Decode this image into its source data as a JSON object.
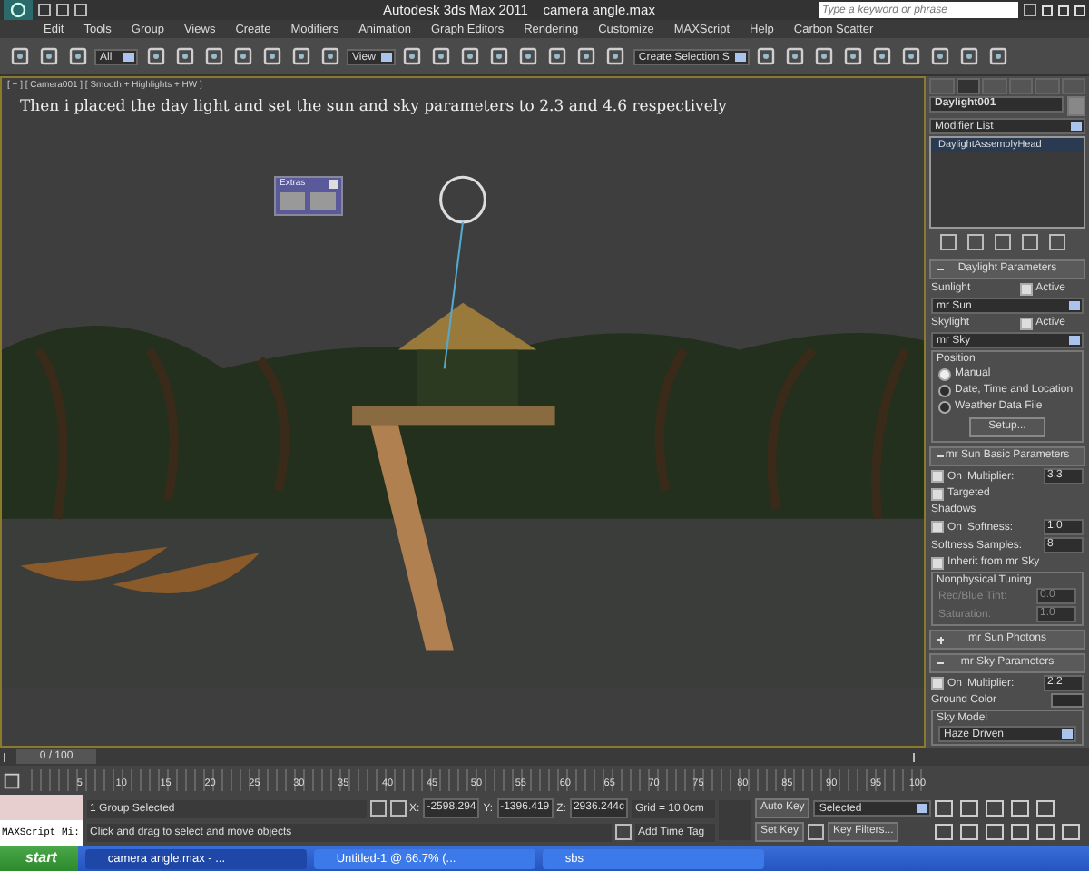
{
  "title_bar": {
    "app": "Autodesk 3ds Max  2011",
    "file": "camera angle.max",
    "search": {
      "placeholder": "Type a keyword or phrase"
    }
  },
  "menu": [
    "Edit",
    "Tools",
    "Group",
    "Views",
    "Create",
    "Modifiers",
    "Animation",
    "Graph Editors",
    "Rendering",
    "Customize",
    "MAXScript",
    "Help",
    "Carbon Scatter"
  ],
  "toolbar": {
    "dropdowns": [
      {
        "value": "All"
      },
      {
        "value": "View"
      },
      {
        "value": "Create Selection S"
      }
    ]
  },
  "viewport": {
    "label": "[ + ] [ Camera001 ] [ Smooth + Highlights + HW ]",
    "caption": "Then i placed the day light and set the sun and sky parameters to 2.3 and 4.6 respectively",
    "extras": {
      "title": "Extras"
    }
  },
  "command_panel": {
    "object_name": "Daylight001",
    "modifier_list": "Modifier List",
    "stack": [
      {
        "label": "DaylightAssemblyHead",
        "selected": true
      }
    ],
    "rollouts": [
      {
        "title": "Daylight Parameters",
        "expanded": true,
        "rows": [
          {
            "kind": "check",
            "label": "Sunlight",
            "check_label": "Active",
            "checked": true
          },
          {
            "kind": "dropdown",
            "value": "mr Sun"
          },
          {
            "kind": "check",
            "label": "Skylight",
            "check_label": "Active",
            "checked": true
          },
          {
            "kind": "dropdown",
            "value": "mr Sky"
          },
          {
            "kind": "group",
            "title": "Position",
            "rows": [
              {
                "kind": "radio",
                "label": "Manual",
                "selected": true
              },
              {
                "kind": "radio",
                "label": "Date, Time and Location",
                "selected": false
              },
              {
                "kind": "radio",
                "label": "Weather Data File",
                "selected": false
              },
              {
                "kind": "button",
                "label": "Setup..."
              }
            ]
          }
        ]
      },
      {
        "title": "mr Sun Basic Parameters",
        "expanded": true,
        "rows": [
          {
            "kind": "check_spinner",
            "label": "On",
            "checked": true,
            "spinner_label": "Multiplier:",
            "value": "3.3"
          },
          {
            "kind": "checkbox",
            "label": "Targeted",
            "checked": true
          },
          {
            "kind": "heading",
            "label": "Shadows"
          },
          {
            "kind": "check_spinner",
            "label": "On",
            "checked": true,
            "spinner_label": "Softness:",
            "value": "1.0"
          },
          {
            "kind": "spinner",
            "label": "Softness Samples:",
            "value": "8",
            "disabled": false
          },
          {
            "kind": "checkbox",
            "label": "Inherit from mr Sky",
            "checked": true
          },
          {
            "kind": "group",
            "title": "Nonphysical Tuning",
            "rows": [
              {
                "kind": "spinner",
                "label": "Red/Blue Tint:",
                "value": "0.0",
                "disabled": true
              },
              {
                "kind": "spinner",
                "label": "Saturation:",
                "value": "1.0",
                "disabled": true
              }
            ]
          }
        ]
      },
      {
        "title": "mr Sun Photons",
        "expanded": false
      },
      {
        "title": "mr Sky Parameters",
        "expanded": true,
        "rows": [
          {
            "kind": "check_spinner",
            "label": "On",
            "checked": true,
            "spinner_label": "Multiplier:",
            "value": "2.2"
          },
          {
            "kind": "swatch",
            "label": "Ground Color"
          },
          {
            "kind": "group",
            "title": "Sky Model",
            "rows": [
              {
                "kind": "dropdown",
                "value": "Haze Driven"
              }
            ]
          }
        ]
      }
    ]
  },
  "timeline": {
    "position": "0 / 100",
    "level": 0,
    "ticks": [
      "5",
      "10",
      "15",
      "20",
      "25",
      "30",
      "35",
      "40",
      "45",
      "50",
      "55",
      "60",
      "65",
      "70",
      "75",
      "80",
      "85",
      "90",
      "95",
      "100"
    ]
  },
  "status": {
    "listener": "MAXScript Mi:",
    "selection": "1 Group Selected",
    "prompt": "Click and drag to select and move objects",
    "coords": [
      {
        "axis": "X:",
        "value": "-2598.294"
      },
      {
        "axis": "Y:",
        "value": "-1396.419"
      },
      {
        "axis": "Z:",
        "value": "2936.244c"
      }
    ],
    "grid": "Grid = 10.0cm",
    "time_tag": "Add Time Tag",
    "auto_key": "Auto Key",
    "set_key": "Set Key",
    "key_mode": "Selected",
    "key_filters": "Key Filters..."
  },
  "taskbar": {
    "start": "start",
    "items": [
      {
        "label": "camera angle.max - ...",
        "selected": true
      },
      {
        "label": "Untitled-1 @ 66.7% (...",
        "selected": false
      },
      {
        "label": "sbs",
        "selected": false
      }
    ]
  }
}
